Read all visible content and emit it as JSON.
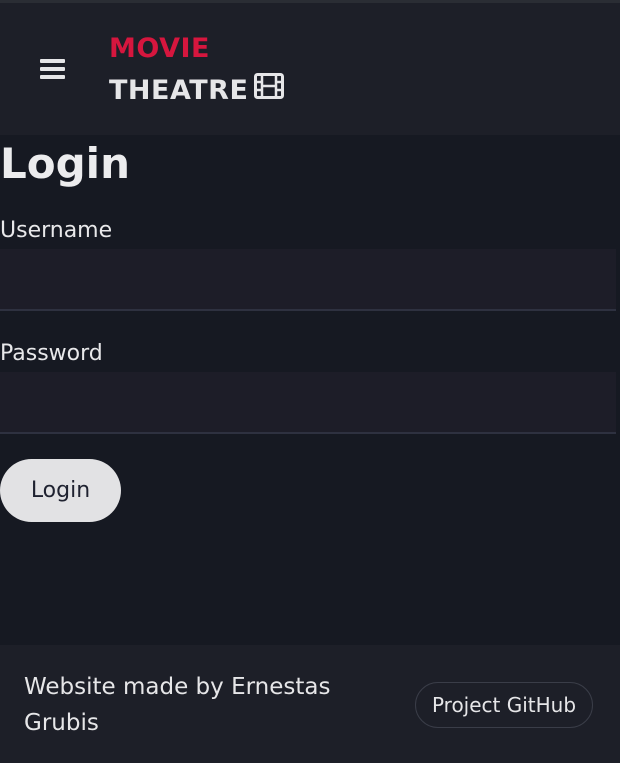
{
  "header": {
    "brand_top": "MOVIE",
    "brand_bottom": "THEATRE",
    "menu_icon": "hamburger-menu-icon",
    "brand_icon": "film-icon"
  },
  "main": {
    "title": "Login",
    "username": {
      "label": "Username",
      "value": "",
      "placeholder": ""
    },
    "password": {
      "label": "Password",
      "value": "",
      "placeholder": ""
    },
    "submit_label": "Login"
  },
  "footer": {
    "credit": "Website made by Ernestas Grubis",
    "github_label": "Project GitHub"
  },
  "colors": {
    "accent": "#d6163e",
    "header_bg": "#1d1f28",
    "page_bg": "#161922",
    "button_bg": "#e2e2e4"
  }
}
